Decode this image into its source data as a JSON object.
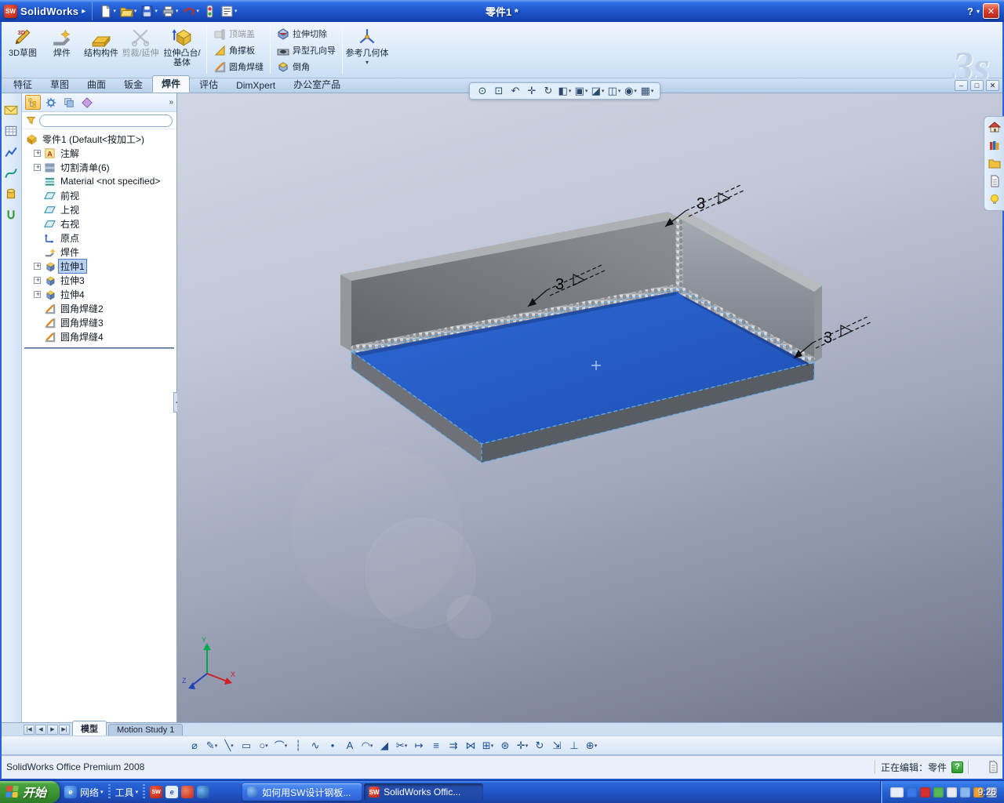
{
  "window": {
    "logo": "SW",
    "app_name": "SolidWorks",
    "doc_title": "零件1 *",
    "help_label": "?",
    "status_left": "SolidWorks Office Premium 2008",
    "status_editing": "正在编辑：零件",
    "status_help": "?"
  },
  "quick_toolbar": {
    "icons": [
      "new-file",
      "open-file",
      "save",
      "print",
      "undo",
      "rebuild",
      "options"
    ]
  },
  "command_manager": {
    "watermark": "3s",
    "large_buttons": [
      {
        "label": "3D草图",
        "disabled": false
      },
      {
        "label": "焊件",
        "disabled": false
      },
      {
        "label": "结构构件",
        "disabled": false
      },
      {
        "label": "剪裁/延伸",
        "disabled": true
      },
      {
        "label": "拉伸凸台/基体",
        "disabled": false
      }
    ],
    "small_buttons_col1": [
      {
        "label": "顶端盖",
        "disabled": true
      },
      {
        "label": "角撑板",
        "disabled": false
      },
      {
        "label": "圆角焊缝",
        "disabled": false
      }
    ],
    "small_buttons_col2": [
      {
        "label": "拉伸切除",
        "disabled": false
      },
      {
        "label": "异型孔向导",
        "disabled": false
      },
      {
        "label": "倒角",
        "disabled": false
      }
    ],
    "ref_geometry_label": "参考几何体"
  },
  "tabs": {
    "items": [
      {
        "label": "特征"
      },
      {
        "label": "草图"
      },
      {
        "label": "曲面"
      },
      {
        "label": "钣金"
      },
      {
        "label": "焊件"
      },
      {
        "label": "评估"
      },
      {
        "label": "DimXpert"
      },
      {
        "label": "办公室产品"
      }
    ]
  },
  "feature_tree": {
    "filter_value": "",
    "root": "零件1 (Default<按加工>)",
    "items": [
      {
        "label": "注解",
        "icon": "annotations"
      },
      {
        "label": "切割清单(6)",
        "icon": "cutlist"
      },
      {
        "label": "Material <not specified>",
        "icon": "material"
      },
      {
        "label": "前视",
        "icon": "plane"
      },
      {
        "label": "上视",
        "icon": "plane"
      },
      {
        "label": "右视",
        "icon": "plane"
      },
      {
        "label": "原点",
        "icon": "origin"
      },
      {
        "label": "焊件",
        "icon": "weldment"
      },
      {
        "label": "拉伸1",
        "icon": "extrude",
        "selected": true
      },
      {
        "label": "拉伸3",
        "icon": "extrude"
      },
      {
        "label": "拉伸4",
        "icon": "extrude"
      },
      {
        "label": "圆角焊缝2",
        "icon": "fillet-bead"
      },
      {
        "label": "圆角焊缝3",
        "icon": "fillet-bead"
      },
      {
        "label": "圆角焊缝4",
        "icon": "fillet-bead"
      }
    ]
  },
  "view_toolbar": {
    "icons": [
      {
        "n": "zoom-fit-icon",
        "g": "⊙"
      },
      {
        "n": "zoom-area-icon",
        "g": "⊡"
      },
      {
        "n": "previous-view-icon",
        "g": "↶"
      },
      {
        "n": "pan-icon",
        "g": "✛"
      },
      {
        "n": "rotate-view-icon",
        "g": "↻"
      },
      {
        "n": "section-view-icon",
        "g": "◧",
        "d": 1
      },
      {
        "n": "view-orientation-icon",
        "g": "▣",
        "d": 1
      },
      {
        "n": "display-style-icon",
        "g": "◪",
        "d": 1
      },
      {
        "n": "hide-show-items-icon",
        "g": "◫",
        "d": 1
      },
      {
        "n": "edit-appearance-icon",
        "g": "◉",
        "d": 1
      },
      {
        "n": "apply-scene-icon",
        "g": "▦",
        "d": 1
      }
    ]
  },
  "bottom_toolbar": {
    "icons": [
      {
        "n": "smart-dimension-icon",
        "g": "⌀"
      },
      {
        "n": "sketch-icon",
        "g": "✎",
        "d": 1
      },
      {
        "n": "line-icon",
        "g": "╲",
        "d": 1
      },
      {
        "n": "rectangle-icon",
        "g": "▭"
      },
      {
        "n": "circle-icon",
        "g": "○",
        "d": 1
      },
      {
        "n": "arc-icon",
        "g": "⌒",
        "d": 1
      },
      {
        "n": "centerline-icon",
        "g": "┆"
      },
      {
        "n": "spline-icon",
        "g": "∿"
      },
      {
        "n": "point-icon",
        "g": "•"
      },
      {
        "n": "text-icon",
        "g": "A"
      },
      {
        "n": "sketch-fillet-icon",
        "g": "◠",
        "d": 1
      },
      {
        "n": "sketch-chamfer-icon",
        "g": "◢"
      },
      {
        "n": "trim-entities-icon",
        "g": "✂",
        "d": 1
      },
      {
        "n": "extend-entities-icon",
        "g": "↦"
      },
      {
        "n": "offset-entities-icon",
        "g": "≡"
      },
      {
        "n": "convert-entities-icon",
        "g": "⇉"
      },
      {
        "n": "mirror-entities-icon",
        "g": "⋈"
      },
      {
        "n": "linear-pattern-icon",
        "g": "⊞",
        "d": 1
      },
      {
        "n": "circular-pattern-icon",
        "g": "⊛"
      },
      {
        "n": "move-entities-icon",
        "g": "✛",
        "d": 1
      },
      {
        "n": "rotate-entities-icon",
        "g": "↻"
      },
      {
        "n": "scale-entities-icon",
        "g": "⇲"
      },
      {
        "n": "display-relations-icon",
        "g": "⊥"
      },
      {
        "n": "quick-snaps-icon",
        "g": "⊕",
        "d": 1
      }
    ]
  },
  "viewport": {
    "weld_label_top": "3",
    "weld_label_mid": "3",
    "weld_label_right": "3",
    "triad": {
      "x": "X",
      "y": "Y",
      "z": "Z"
    }
  },
  "bottom_tabs": {
    "model": "模型",
    "motion": "Motion Study 1"
  },
  "taskbar": {
    "start": "开始",
    "ie_glyph": "e",
    "sw_glyph": "SW",
    "quick_net": "网络",
    "quick_tools": "工具",
    "tasks": [
      {
        "label": "如何用SW设计钢板...",
        "active": false
      },
      {
        "label": "SolidWorks Offic...",
        "active": true
      }
    ],
    "tray": [
      {
        "n": "input-method-icon",
        "css": "background:#e8eef8;width:17px"
      },
      {
        "n": "tray-icon-im",
        "css": "background:#3a78e8"
      },
      {
        "n": "tray-icon-antivirus",
        "css": "background:#d43030"
      },
      {
        "n": "tray-icon-updater",
        "css": "background:#58b858"
      },
      {
        "n": "tray-icon-volume",
        "css": "background:#e8e8f0"
      },
      {
        "n": "tray-icon-network",
        "css": "background:#88b8f0"
      },
      {
        "n": "tray-icon-security",
        "css": "background:#f0a030"
      },
      {
        "n": "tray-icon-display",
        "css": "background:#c0c8d8"
      }
    ],
    "clock": "9:26"
  }
}
